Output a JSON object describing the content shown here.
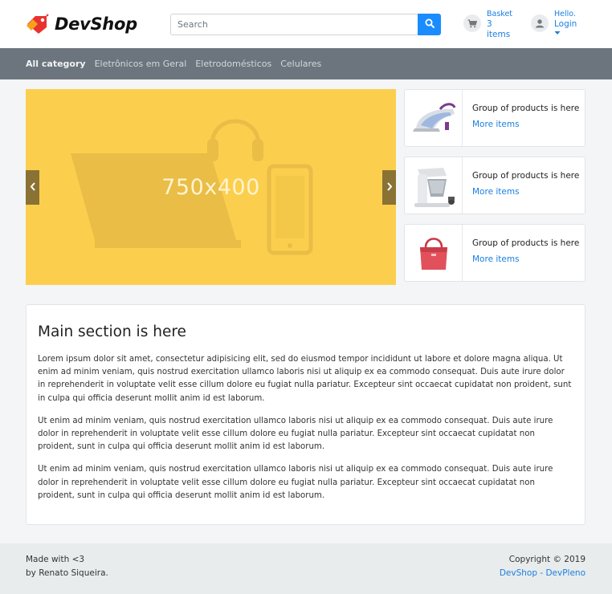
{
  "header": {
    "logo_text": "DevShop",
    "search": {
      "placeholder": "Search",
      "value": ""
    },
    "basket": {
      "title": "Basket",
      "count": "3",
      "unit": "items"
    },
    "login": {
      "greeting": "Hello.",
      "label": "Login"
    }
  },
  "nav": {
    "items": [
      "All category",
      "Eletrônicos em Geral",
      "Eletrodomésticos",
      "Celulares"
    ]
  },
  "carousel": {
    "placeholder_label": "750x400"
  },
  "side_cards": [
    {
      "title": "Group of products is here",
      "link": "More items",
      "image": "steam-iron"
    },
    {
      "title": "Group of products is here",
      "link": "More items",
      "image": "stand-mixer"
    },
    {
      "title": "Group of products is here",
      "link": "More items",
      "image": "handbag"
    }
  ],
  "main": {
    "title": "Main section is here",
    "paragraphs": [
      "Lorem ipsum dolor sit amet, consectetur adipisicing elit, sed do eiusmod tempor incididunt ut labore et dolore magna aliqua. Ut enim ad minim veniam, quis nostrud exercitation ullamco laboris nisi ut aliquip ex ea commodo consequat. Duis aute irure dolor in reprehenderit in voluptate velit esse cillum dolore eu fugiat nulla pariatur. Excepteur sint occaecat cupidatat non proident, sunt in culpa qui officia deserunt mollit anim id est laborum.",
      "Ut enim ad minim veniam, quis nostrud exercitation ullamco laboris nisi ut aliquip ex ea commodo consequat. Duis aute irure dolor in reprehenderit in voluptate velit esse cillum dolore eu fugiat nulla pariatur. Excepteur sint occaecat cupidatat non proident, sunt in culpa qui officia deserunt mollit anim id est laborum.",
      "Ut enim ad minim veniam, quis nostrud exercitation ullamco laboris nisi ut aliquip ex ea commodo consequat. Duis aute irure dolor in reprehenderit in voluptate velit esse cillum dolore eu fugiat nulla pariatur. Excepteur sint occaecat cupidatat non proident, sunt in culpa qui officia deserunt mollit anim id est laborum."
    ]
  },
  "footer": {
    "made_with": "Made with <3",
    "author": "by Renato Siqueira.",
    "copyright": "Copyright © 2019",
    "link": "DevShop - DevPleno"
  },
  "colors": {
    "accent": "#1a8cff",
    "nav_bg": "#6c757d",
    "carousel_bg": "#fbcf4d",
    "footer_bg": "#e9ecec"
  }
}
